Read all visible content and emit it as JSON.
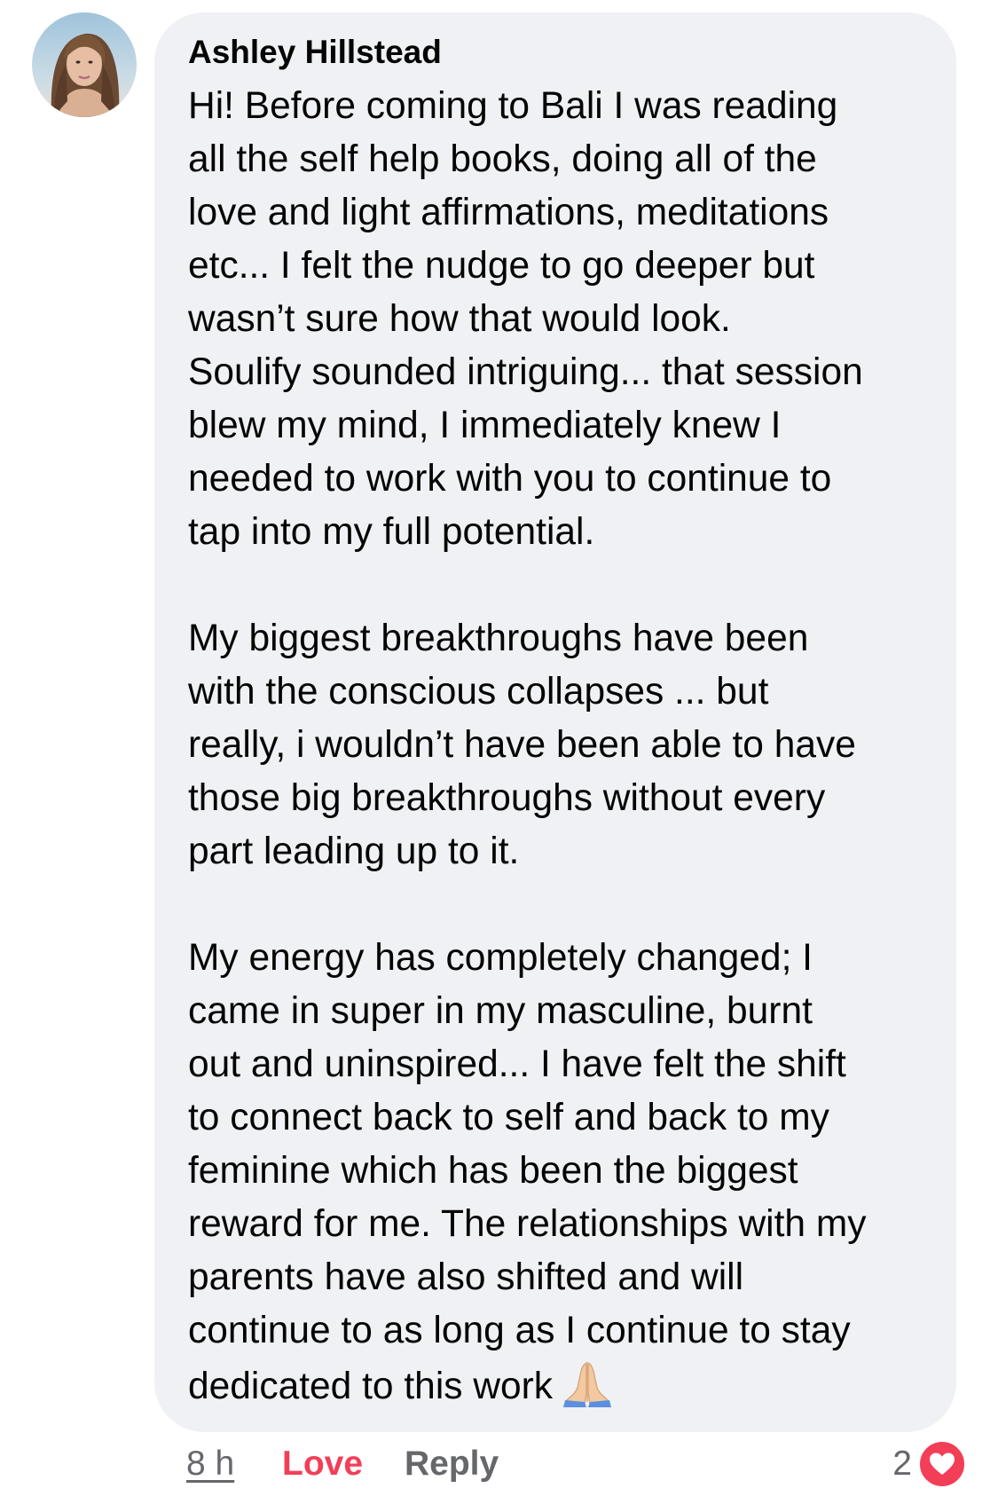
{
  "comment": {
    "author": "Ashley Hillstead",
    "paragraphs": [
      [
        "Hi! Before coming to Bali I was reading",
        "all the self help books, doing all of the",
        "love and light affirmations, meditations",
        "etc... I felt the nudge to go deeper but",
        "wasn’t sure how that would look.",
        "Soulify sounded intriguing... that session",
        "blew my mind, I immediately knew I",
        "needed to work with you to continue to",
        "tap into my full potential."
      ],
      [
        "My biggest breakthroughs have been",
        "with the conscious collapses ... but",
        "really, i wouldn’t have been able to have",
        "those big breakthroughs without every",
        "part leading up to it."
      ],
      [
        "My energy has completely changed; I",
        "came in super in my masculine, burnt",
        "out and uninspired... I have felt the shift",
        "to connect back to self and back to my",
        "feminine which has been the biggest",
        "reward for me. The relationships with my",
        "parents have also shifted and will",
        "continue to as long as I continue to stay",
        "dedicated to this work"
      ]
    ],
    "end_emoji": "folded-hands-emoji"
  },
  "actions": {
    "time": "8 h",
    "love_label": "Love",
    "reply_label": "Reply",
    "reaction_count": "2",
    "reaction_icon": "heart-reaction-icon"
  },
  "colors": {
    "bubble_bg": "#f0f1f4",
    "love_red": "#f33e58",
    "meta_gray": "#65676b",
    "text": "#050505"
  }
}
